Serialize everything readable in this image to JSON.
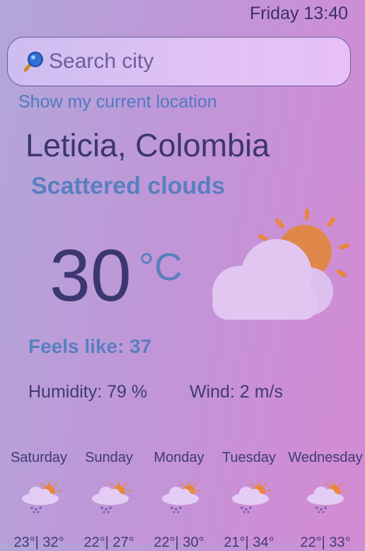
{
  "header": {
    "datetime": "Friday 13:40"
  },
  "search": {
    "placeholder": "Search city",
    "value": ""
  },
  "location_link": "Show my current location",
  "current": {
    "city": "Leticia, Colombia",
    "condition": "Scattered clouds",
    "temperature": "30",
    "unit": "°C",
    "feels_like": "Feels like: 37",
    "humidity": "Humidity: 79 %",
    "wind": "Wind: 2 m/s",
    "icon": "partly-cloudy-icon"
  },
  "forecast": [
    {
      "day": "Saturday",
      "temps": "23°| 32°",
      "icon": "rain-sun-icon"
    },
    {
      "day": "Sunday",
      "temps": "22°| 27°",
      "icon": "rain-sun-icon"
    },
    {
      "day": "Monday",
      "temps": "22°| 30°",
      "icon": "rain-sun-icon"
    },
    {
      "day": "Tuesday",
      "temps": "21°| 34°",
      "icon": "rain-sun-icon"
    },
    {
      "day": "Wednesday",
      "temps": "22°| 33°",
      "icon": "rain-sun-icon"
    }
  ],
  "colors": {
    "sun": "#e8873c",
    "cloud": "#e2c6f2",
    "text_dark": "#3c3672",
    "text_accent": "#5a7fc0"
  }
}
